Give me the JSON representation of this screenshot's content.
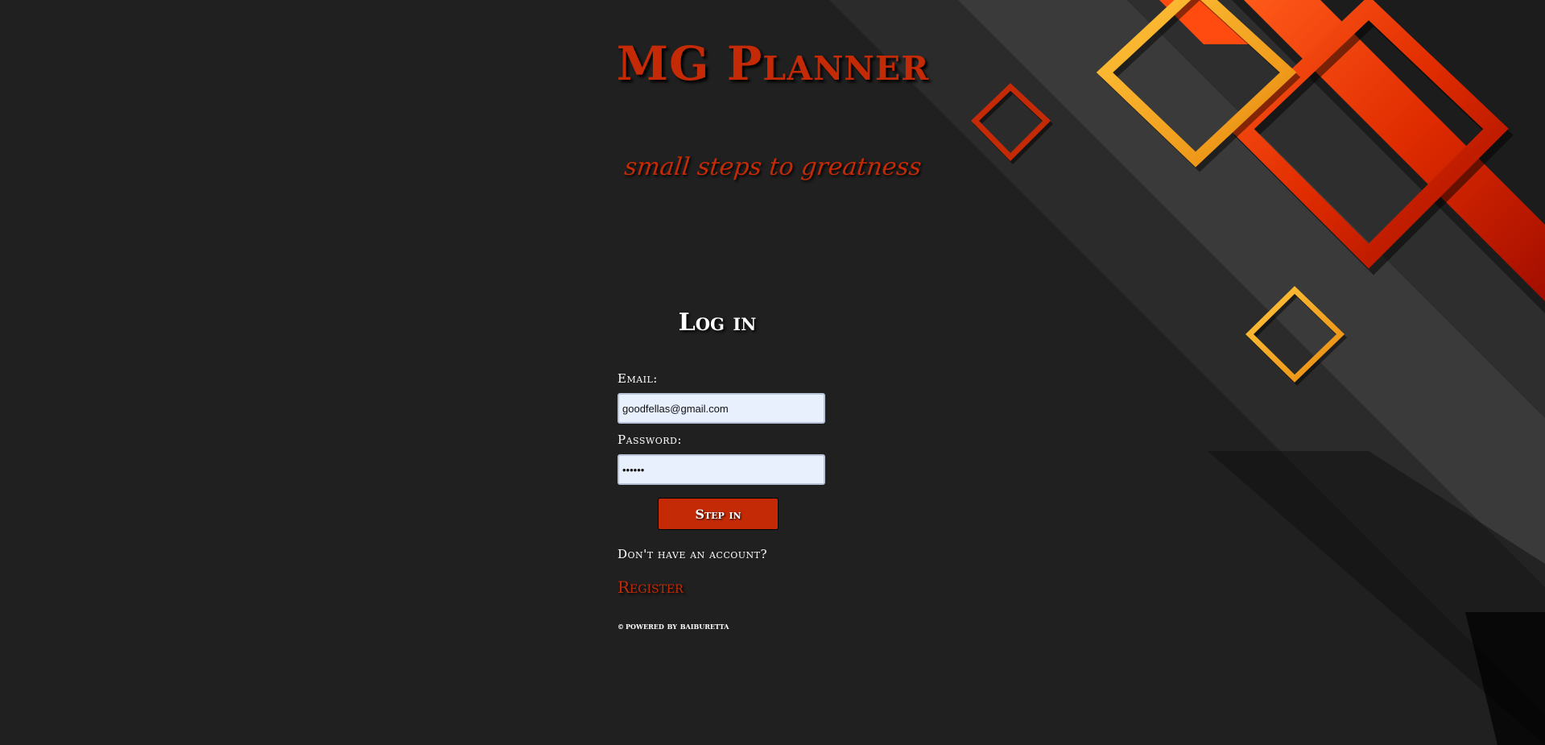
{
  "app": {
    "title": "MG Planner",
    "tagline": "small steps to greatness"
  },
  "login": {
    "heading": "Log in",
    "email_label": "Email:",
    "email_value": "goodfellas@gmail.com",
    "password_label": "Password:",
    "password_value": "••••••",
    "submit_label": "Step in",
    "no_account_text": "Don't have an account?",
    "register_label": "Register"
  },
  "footer": {
    "copyright_icon": "copyright-icon",
    "copyright_symbol": "©",
    "text": "powered by baiburetta"
  },
  "colors": {
    "background": "#202020",
    "accent": "#c42a06",
    "accent_orange": "#f5a21a",
    "input_background": "#e8f0fe",
    "text": "#ffffff"
  }
}
